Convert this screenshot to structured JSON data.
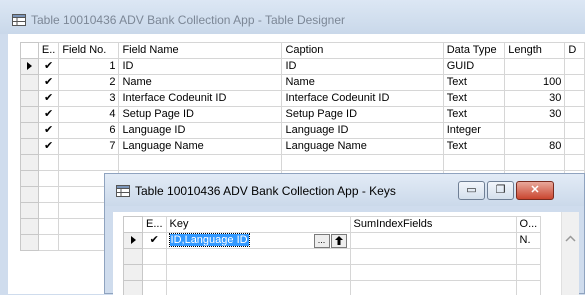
{
  "main_window": {
    "title": "Table 10010436 ADV Bank Collection App - Table Designer",
    "columns": [
      "E..",
      "Field No.",
      "Field Name",
      "Caption",
      "Data Type",
      "Length",
      "D"
    ],
    "rows": [
      {
        "enabled": "✔",
        "no": "1",
        "name": "ID",
        "caption": "ID",
        "type": "GUID",
        "length": ""
      },
      {
        "enabled": "✔",
        "no": "2",
        "name": "Name",
        "caption": "Name",
        "type": "Text",
        "length": "100"
      },
      {
        "enabled": "✔",
        "no": "3",
        "name": "Interface Codeunit ID",
        "caption": "Interface Codeunit ID",
        "type": "Text",
        "length": "30"
      },
      {
        "enabled": "✔",
        "no": "4",
        "name": "Setup Page ID",
        "caption": "Setup Page ID",
        "type": "Text",
        "length": "30"
      },
      {
        "enabled": "✔",
        "no": "6",
        "name": "Language ID",
        "caption": "Language ID",
        "type": "Integer",
        "length": ""
      },
      {
        "enabled": "✔",
        "no": "7",
        "name": "Language Name",
        "caption": "Language Name",
        "type": "Text",
        "length": "80"
      }
    ]
  },
  "keys_dialog": {
    "title": "Table 10010436 ADV Bank Collection App - Keys",
    "columns": [
      "E...",
      "Key",
      "SumIndexFields",
      "O..."
    ],
    "row": {
      "enabled": "✔",
      "key": "ID,Language ID",
      "o": "N."
    },
    "minimize": "▭",
    "restore": "❐",
    "close": "✕",
    "ellipsis": "...",
    "arrow": "🡅"
  }
}
